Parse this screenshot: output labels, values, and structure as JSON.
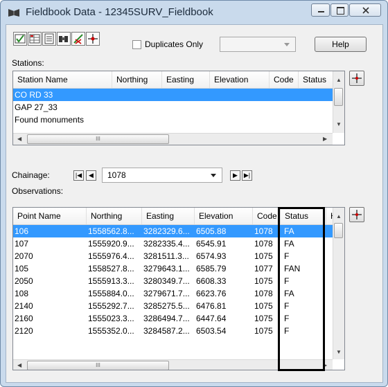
{
  "window": {
    "title": "Fieldbook Data - 12345SURV_Fieldbook"
  },
  "toolbar": {
    "duplicates_label": "Duplicates Only",
    "help_label": "Help",
    "icons": [
      "check-table-icon",
      "table-icon",
      "list-icon",
      "find-icon",
      "edit-icon",
      "point-icon"
    ]
  },
  "stations": {
    "label": "Stations:",
    "columns": [
      "Station Name",
      "Northing",
      "Easting",
      "Elevation",
      "Code",
      "Status"
    ],
    "rows": [
      "CO RD 33",
      "GAP 27_33",
      "Found monuments"
    ],
    "selected_row": 0,
    "hscroll_mark": "III"
  },
  "chainage": {
    "label": "Chainage:",
    "value": "1078"
  },
  "observations": {
    "label": "Observations:",
    "columns": [
      "Point Name",
      "Northing",
      "Easting",
      "Elevation",
      "Code",
      "Status",
      "Hc"
    ],
    "rows": [
      [
        "106",
        "1558562.8...",
        "3282329.6...",
        "6505.88",
        "1078",
        "FA"
      ],
      [
        "107",
        "1555920.9...",
        "3282335.4...",
        "6545.91",
        "1078",
        "FA"
      ],
      [
        "2070",
        "1555976.4...",
        "3281511.3...",
        "6574.93",
        "1075",
        "F"
      ],
      [
        "105",
        "1558527.8...",
        "3279643.1...",
        "6585.79",
        "1077",
        "FAN"
      ],
      [
        "2050",
        "1555913.3...",
        "3280349.7...",
        "6608.33",
        "1075",
        "F"
      ],
      [
        "108",
        "1555884.0...",
        "3279671.7...",
        "6623.76",
        "1078",
        "FA"
      ],
      [
        "2140",
        "1555292.7...",
        "3285275.5...",
        "6476.81",
        "1075",
        "F"
      ],
      [
        "2160",
        "1555023.3...",
        "3286494.7...",
        "6447.64",
        "1075",
        "F"
      ],
      [
        "2120",
        "1555352.0...",
        "3284587.2...",
        "6503.54",
        "1075",
        "F"
      ]
    ],
    "selected_row": 0,
    "hscroll_mark": "III"
  },
  "colors": {
    "selection": "#3399ff",
    "highlight_box": "#000000"
  }
}
